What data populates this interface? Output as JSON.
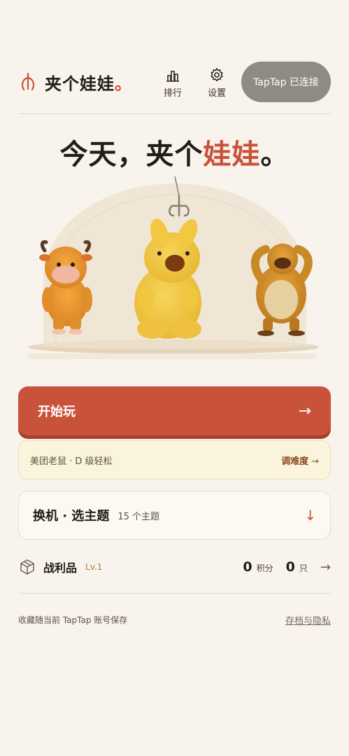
{
  "header": {
    "logo_text": "夹个娃娃",
    "logo_dot": "。",
    "rank_label": "排行",
    "settings_label": "设置",
    "taptap_status": "TapTap 已连接"
  },
  "hero": {
    "title_prefix": "今天，夹个",
    "title_accent": "娃娃",
    "title_suffix": "。"
  },
  "actions": {
    "play_label": "开始玩",
    "play_arrow": "→",
    "difficulty_text": "美团老鼠 · D 级轻松",
    "adjust_label": "调难度",
    "adjust_arrow": "→"
  },
  "theme": {
    "title": "换机 · 选主题",
    "count": "15 个主题",
    "arrow": "↓"
  },
  "loot": {
    "title": "战利品",
    "level": "Lv.1",
    "points": "0",
    "points_unit": "积分",
    "items": "0",
    "items_unit": "只",
    "arrow": "→"
  },
  "footer": {
    "note": "收藏随当前 TapTap 账号保存",
    "privacy": "存档与隐私"
  },
  "icons": {
    "logo": "claw-icon",
    "rank": "bar-chart-icon",
    "settings": "gear-icon",
    "loot": "box-icon"
  },
  "colors": {
    "accent": "#c9533a",
    "background": "#f8f3ec",
    "tap_button": "#8f8a84"
  }
}
